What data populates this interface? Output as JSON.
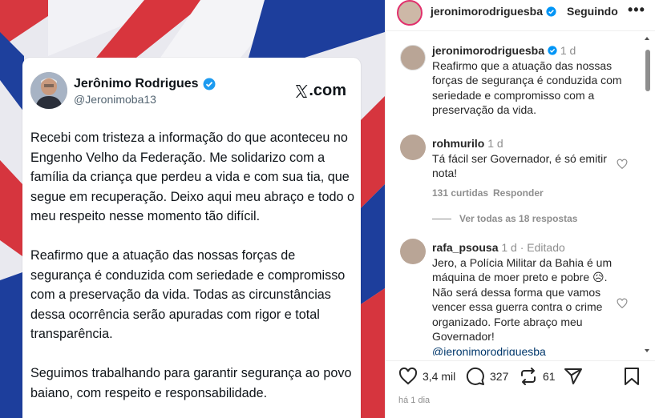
{
  "tweet_card": {
    "name": "Jerônimo Rodrigues",
    "handle": "@Jeronimoba13",
    "brand_domain": ".com",
    "paragraphs": [
      "Recebi com tristeza a informação do que aconteceu no Engenho Velho da Federação. Me solidarizo com a família da criança que perdeu a vida e com sua tia, que segue em recuperação. Deixo aqui meu abraço e todo o meu respeito nesse momento tão difícil.",
      "Reafirmo que a atuação das nossas forças de segurança é conduzida com seriedade e compromisso com a preservação da vida. Todas as circunstâncias dessa ocorrência serão apuradas com rigor e total transparência.",
      "Seguimos trabalhando para garantir segurança ao povo baiano, com respeito e responsabilidade."
    ]
  },
  "post": {
    "header": {
      "username": "jeronimorodriguesba",
      "follow_label": "Seguindo",
      "more": "•••"
    },
    "caption": {
      "username": "jeronimorodriguesba",
      "time": "1 d",
      "text": "Reafirmo que a atuação das nossas forças de segurança é conduzida com seriedade e compromisso com a preservação da vida."
    },
    "comments": [
      {
        "username": "rohmurilo",
        "time": "1 d",
        "text": "Tá fácil ser Governador, é só emitir nota!",
        "likes": "131 curtidas",
        "reply": "Responder",
        "view_replies": "Ver todas as 18 respostas"
      },
      {
        "username": "rafa_psousa",
        "time": "1 d · Editado",
        "text_before": "Jero, a Polícia Militar da Bahia é um máquina de moer preto e pobre ",
        "emoji": "😥",
        "text_after": ". Não será dessa forma que vamos vencer essa guerra contra o crime organizado. Forte abraço meu Governador!",
        "mention": "@jeronimorodriguesba"
      }
    ],
    "actions": {
      "likes": "3,4 mil",
      "comments": "327",
      "reposts": "61"
    },
    "date": "há 1 dia"
  },
  "colors": {
    "verified": "#0095f6",
    "text": "#262626",
    "muted": "#8e8e8e",
    "stripe_red": "#e3323c",
    "stripe_blue": "#1c3f9e"
  }
}
